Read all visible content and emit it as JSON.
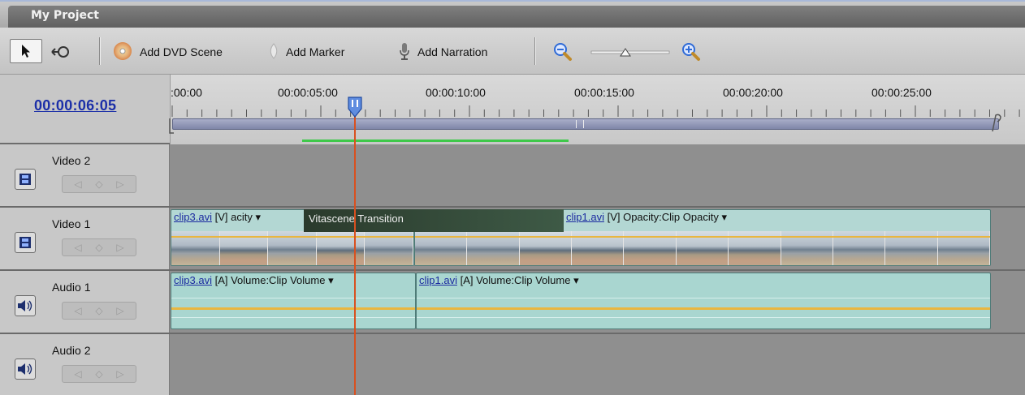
{
  "window": {
    "title": "My Project"
  },
  "toolbar": {
    "add_dvd_scene": "Add DVD Scene",
    "add_marker": "Add Marker",
    "add_narration": "Add Narration"
  },
  "timeline": {
    "current_time": "00:00:06:05",
    "ruler_labels": [
      ":00:00",
      "00:00:05:00",
      "00:00:10:00",
      "00:00:15:00",
      "00:00:20:00",
      "00:00:25:00"
    ]
  },
  "tracks": {
    "video2": {
      "name": "Video 2"
    },
    "video1": {
      "name": "Video 1",
      "clip1_file": "clip3.avi",
      "clip1_suffix": " [V] acity",
      "transition": "Vitascene Transition",
      "clip2_file": "clip1.avi",
      "clip2_suffix": " [V] Opacity:Clip Opacity"
    },
    "audio1": {
      "name": "Audio 1",
      "clip1_file": "clip3.avi",
      "clip1_suffix": " [A] Volume:Clip Volume",
      "clip2_file": "clip1.avi",
      "clip2_suffix": " [A] Volume:Clip Volume"
    },
    "audio2": {
      "name": "Audio 2"
    }
  },
  "colors": {
    "timecode": "#1c2fa8",
    "playhead": "#d9501f",
    "work_area": "#3fc84a",
    "clip": "#b3d7d3",
    "keyframe_line": "#e9b640"
  },
  "icons": {
    "select_tool": "arrow-cursor-icon",
    "time_stretch_tool": "time-stretch-icon",
    "dvd": "dvd-disc-icon",
    "marker": "marker-icon",
    "narration": "microphone-icon",
    "zoom_out": "zoom-out-icon",
    "zoom_in": "zoom-in-icon",
    "video_track": "film-icon",
    "audio_track": "speaker-icon"
  }
}
